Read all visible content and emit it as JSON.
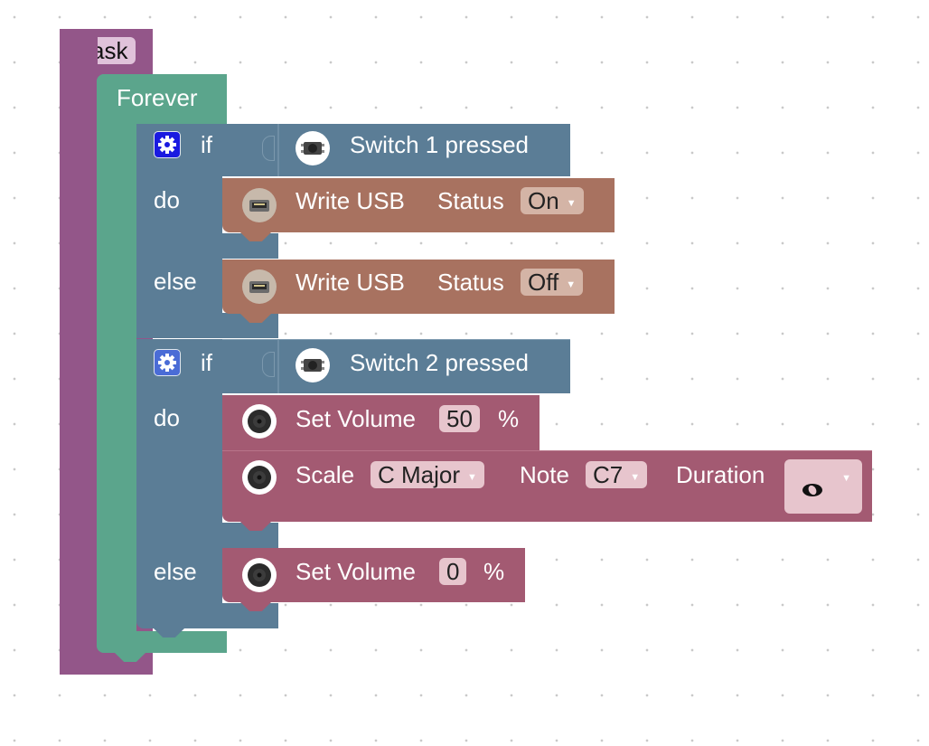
{
  "workspace": {
    "task": {
      "label": "Task"
    },
    "forever": {
      "label": "Forever"
    },
    "if1": {
      "if_label": "if",
      "condition": "Switch 1 pressed",
      "do_label": "do",
      "else_label": "else",
      "do_block": {
        "label": "Write USB",
        "status_label": "Status",
        "status_value": "On"
      },
      "else_block": {
        "label": "Write USB",
        "status_label": "Status",
        "status_value": "Off"
      }
    },
    "if2": {
      "if_label": "if",
      "condition": "Switch 2 pressed",
      "do_label": "do",
      "else_label": "else",
      "set_volume": {
        "label": "Set Volume",
        "value": "50",
        "unit": "%"
      },
      "scale": {
        "label": "Scale",
        "scale_value": "C Major",
        "note_label": "Note",
        "note_value": "C7",
        "duration_label": "Duration",
        "duration_icon": "whole-note-icon"
      },
      "else_volume": {
        "label": "Set Volume",
        "value": "0",
        "unit": "%"
      }
    },
    "colors": {
      "task": "#935689",
      "forever": "#5ba58c",
      "control": "#5b7d96",
      "usb": "#a87260",
      "sound": "#a35a72",
      "gear": "#1a1ae0"
    }
  }
}
